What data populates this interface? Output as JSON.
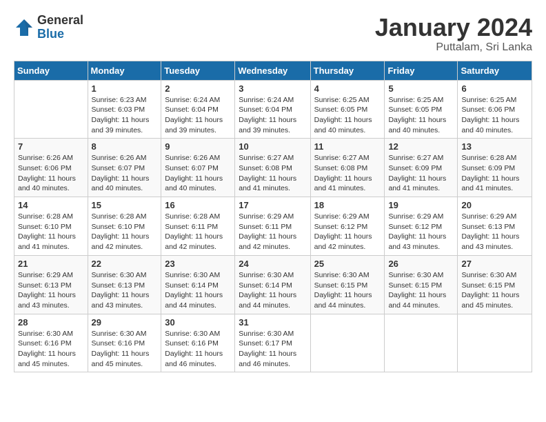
{
  "logo": {
    "general": "General",
    "blue": "Blue"
  },
  "title": {
    "month": "January 2024",
    "location": "Puttalam, Sri Lanka"
  },
  "weekdays": [
    "Sunday",
    "Monday",
    "Tuesday",
    "Wednesday",
    "Thursday",
    "Friday",
    "Saturday"
  ],
  "weeks": [
    [
      {
        "day": "",
        "sunrise": "",
        "sunset": "",
        "daylight": ""
      },
      {
        "day": "1",
        "sunrise": "Sunrise: 6:23 AM",
        "sunset": "Sunset: 6:03 PM",
        "daylight": "Daylight: 11 hours and 39 minutes."
      },
      {
        "day": "2",
        "sunrise": "Sunrise: 6:24 AM",
        "sunset": "Sunset: 6:04 PM",
        "daylight": "Daylight: 11 hours and 39 minutes."
      },
      {
        "day": "3",
        "sunrise": "Sunrise: 6:24 AM",
        "sunset": "Sunset: 6:04 PM",
        "daylight": "Daylight: 11 hours and 39 minutes."
      },
      {
        "day": "4",
        "sunrise": "Sunrise: 6:25 AM",
        "sunset": "Sunset: 6:05 PM",
        "daylight": "Daylight: 11 hours and 40 minutes."
      },
      {
        "day": "5",
        "sunrise": "Sunrise: 6:25 AM",
        "sunset": "Sunset: 6:05 PM",
        "daylight": "Daylight: 11 hours and 40 minutes."
      },
      {
        "day": "6",
        "sunrise": "Sunrise: 6:25 AM",
        "sunset": "Sunset: 6:06 PM",
        "daylight": "Daylight: 11 hours and 40 minutes."
      }
    ],
    [
      {
        "day": "7",
        "sunrise": "Sunrise: 6:26 AM",
        "sunset": "Sunset: 6:06 PM",
        "daylight": "Daylight: 11 hours and 40 minutes."
      },
      {
        "day": "8",
        "sunrise": "Sunrise: 6:26 AM",
        "sunset": "Sunset: 6:07 PM",
        "daylight": "Daylight: 11 hours and 40 minutes."
      },
      {
        "day": "9",
        "sunrise": "Sunrise: 6:26 AM",
        "sunset": "Sunset: 6:07 PM",
        "daylight": "Daylight: 11 hours and 40 minutes."
      },
      {
        "day": "10",
        "sunrise": "Sunrise: 6:27 AM",
        "sunset": "Sunset: 6:08 PM",
        "daylight": "Daylight: 11 hours and 41 minutes."
      },
      {
        "day": "11",
        "sunrise": "Sunrise: 6:27 AM",
        "sunset": "Sunset: 6:08 PM",
        "daylight": "Daylight: 11 hours and 41 minutes."
      },
      {
        "day": "12",
        "sunrise": "Sunrise: 6:27 AM",
        "sunset": "Sunset: 6:09 PM",
        "daylight": "Daylight: 11 hours and 41 minutes."
      },
      {
        "day": "13",
        "sunrise": "Sunrise: 6:28 AM",
        "sunset": "Sunset: 6:09 PM",
        "daylight": "Daylight: 11 hours and 41 minutes."
      }
    ],
    [
      {
        "day": "14",
        "sunrise": "Sunrise: 6:28 AM",
        "sunset": "Sunset: 6:10 PM",
        "daylight": "Daylight: 11 hours and 41 minutes."
      },
      {
        "day": "15",
        "sunrise": "Sunrise: 6:28 AM",
        "sunset": "Sunset: 6:10 PM",
        "daylight": "Daylight: 11 hours and 42 minutes."
      },
      {
        "day": "16",
        "sunrise": "Sunrise: 6:28 AM",
        "sunset": "Sunset: 6:11 PM",
        "daylight": "Daylight: 11 hours and 42 minutes."
      },
      {
        "day": "17",
        "sunrise": "Sunrise: 6:29 AM",
        "sunset": "Sunset: 6:11 PM",
        "daylight": "Daylight: 11 hours and 42 minutes."
      },
      {
        "day": "18",
        "sunrise": "Sunrise: 6:29 AM",
        "sunset": "Sunset: 6:12 PM",
        "daylight": "Daylight: 11 hours and 42 minutes."
      },
      {
        "day": "19",
        "sunrise": "Sunrise: 6:29 AM",
        "sunset": "Sunset: 6:12 PM",
        "daylight": "Daylight: 11 hours and 43 minutes."
      },
      {
        "day": "20",
        "sunrise": "Sunrise: 6:29 AM",
        "sunset": "Sunset: 6:13 PM",
        "daylight": "Daylight: 11 hours and 43 minutes."
      }
    ],
    [
      {
        "day": "21",
        "sunrise": "Sunrise: 6:29 AM",
        "sunset": "Sunset: 6:13 PM",
        "daylight": "Daylight: 11 hours and 43 minutes."
      },
      {
        "day": "22",
        "sunrise": "Sunrise: 6:30 AM",
        "sunset": "Sunset: 6:13 PM",
        "daylight": "Daylight: 11 hours and 43 minutes."
      },
      {
        "day": "23",
        "sunrise": "Sunrise: 6:30 AM",
        "sunset": "Sunset: 6:14 PM",
        "daylight": "Daylight: 11 hours and 44 minutes."
      },
      {
        "day": "24",
        "sunrise": "Sunrise: 6:30 AM",
        "sunset": "Sunset: 6:14 PM",
        "daylight": "Daylight: 11 hours and 44 minutes."
      },
      {
        "day": "25",
        "sunrise": "Sunrise: 6:30 AM",
        "sunset": "Sunset: 6:15 PM",
        "daylight": "Daylight: 11 hours and 44 minutes."
      },
      {
        "day": "26",
        "sunrise": "Sunrise: 6:30 AM",
        "sunset": "Sunset: 6:15 PM",
        "daylight": "Daylight: 11 hours and 44 minutes."
      },
      {
        "day": "27",
        "sunrise": "Sunrise: 6:30 AM",
        "sunset": "Sunset: 6:15 PM",
        "daylight": "Daylight: 11 hours and 45 minutes."
      }
    ],
    [
      {
        "day": "28",
        "sunrise": "Sunrise: 6:30 AM",
        "sunset": "Sunset: 6:16 PM",
        "daylight": "Daylight: 11 hours and 45 minutes."
      },
      {
        "day": "29",
        "sunrise": "Sunrise: 6:30 AM",
        "sunset": "Sunset: 6:16 PM",
        "daylight": "Daylight: 11 hours and 45 minutes."
      },
      {
        "day": "30",
        "sunrise": "Sunrise: 6:30 AM",
        "sunset": "Sunset: 6:16 PM",
        "daylight": "Daylight: 11 hours and 46 minutes."
      },
      {
        "day": "31",
        "sunrise": "Sunrise: 6:30 AM",
        "sunset": "Sunset: 6:17 PM",
        "daylight": "Daylight: 11 hours and 46 minutes."
      },
      {
        "day": "",
        "sunrise": "",
        "sunset": "",
        "daylight": ""
      },
      {
        "day": "",
        "sunrise": "",
        "sunset": "",
        "daylight": ""
      },
      {
        "day": "",
        "sunrise": "",
        "sunset": "",
        "daylight": ""
      }
    ]
  ]
}
